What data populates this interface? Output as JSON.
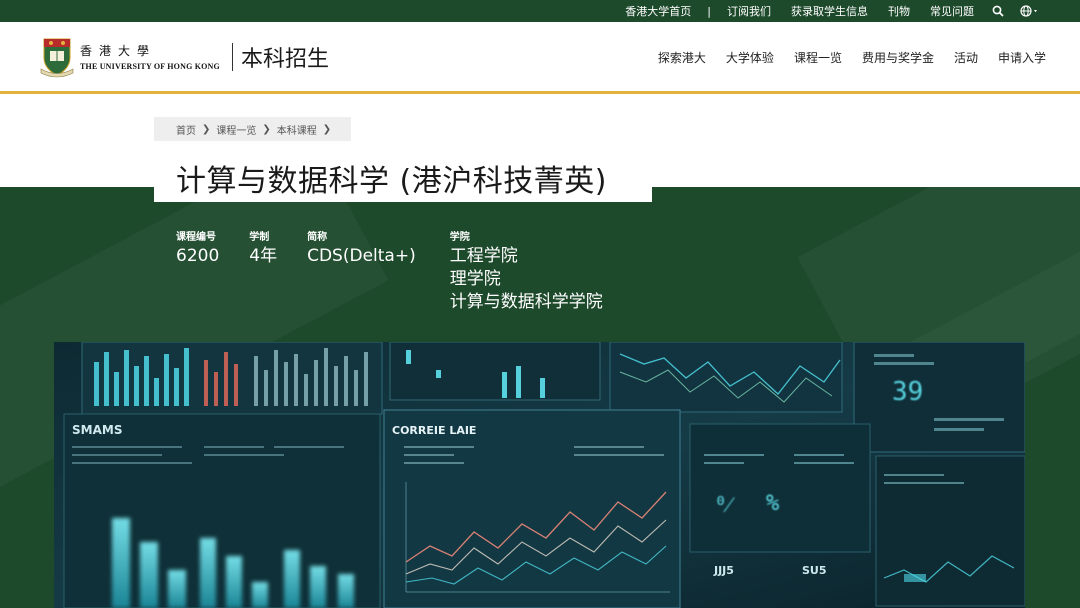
{
  "topbar": {
    "links": [
      "香港大学首页",
      "订阅我们",
      "获录取学生信息",
      "刊物",
      "常见问题"
    ],
    "separator": "|",
    "search_icon": "search-icon",
    "language_icon": "globe-icon"
  },
  "header": {
    "university_cn": "香港大學",
    "university_en": "THE UNIVERSITY OF HONG KONG",
    "site_title": "本科招生",
    "logo_icon": "hku-crest-icon",
    "nav": [
      "探索港大",
      "大学体验",
      "课程一览",
      "费用与奖学金",
      "活动",
      "申请入学"
    ]
  },
  "breadcrumb": [
    "首页",
    "课程一览",
    "本科课程"
  ],
  "course": {
    "title": "计算与数据科学 (港沪科技菁英)",
    "code_label": "课程编号",
    "code": "6200",
    "duration_label": "学制",
    "duration": "4年",
    "abbr_label": "简称",
    "abbr": "CDS(Delta+)",
    "school_label": "学院",
    "schools": [
      "工程学院",
      "理学院",
      "计算与数据科学学院"
    ]
  },
  "hero_image": {
    "label_left": "SMAMS",
    "label_center": "CORREIE LAIE",
    "label_upper_right": "39",
    "label_bottom_1": "JJJ5",
    "label_bottom_2": "SU5"
  },
  "colors": {
    "brand_green": "#1e4a2c",
    "accent_gold": "#e3b23c",
    "hero_cyan": "#4fd8e6"
  }
}
